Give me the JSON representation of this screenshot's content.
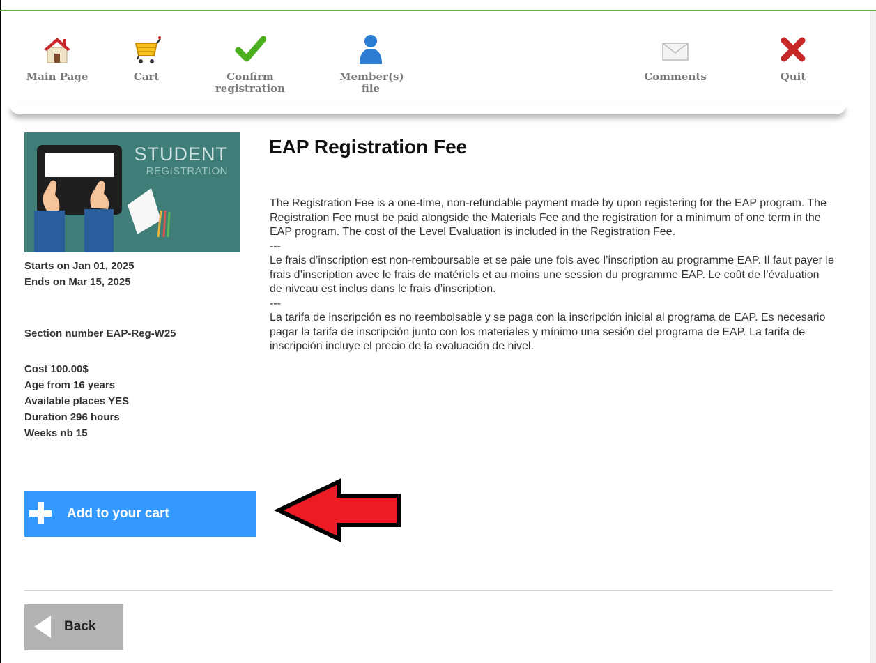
{
  "nav": {
    "items": [
      {
        "label": "Main Page",
        "icon": "home-icon"
      },
      {
        "label": "Cart",
        "icon": "cart-icon"
      },
      {
        "label": "Confirm registration",
        "icon": "checkmark-icon"
      },
      {
        "label": "Member(s) file",
        "icon": "person-icon"
      },
      {
        "label": "Comments",
        "icon": "envelope-icon"
      },
      {
        "label": "Quit",
        "icon": "close-icon"
      }
    ]
  },
  "course": {
    "image_text": {
      "line1": "STUDENT",
      "line2": "REGISTRATION"
    },
    "title": "EAP Registration Fee",
    "starts": "Starts on Jan 01, 2025",
    "ends": "Ends on Mar 15, 2025",
    "section": "Section number EAP-Reg-W25",
    "cost": "Cost 100.00$",
    "age": "Age from 16 years",
    "available": "Available places YES",
    "duration": "Duration 296 hours",
    "weeks": "Weeks nb 15",
    "description": {
      "en": "The Registration Fee is a one-time, non-refundable payment made by upon registering for the EAP program. The Registration Fee must be paid alongside the Materials Fee and the registration for a minimum of one term in the EAP program. The cost of the Level Evaluation is included in the Registration Fee.",
      "sep1": "---",
      "fr": "Le frais d’inscription est non-remboursable et se paie une fois avec l’inscription au programme EAP. Il faut payer le frais d’inscription avec le frais de matériels et au moins une session du programme EAP. Le coût de l’évaluation de niveau est inclus dans le frais d’inscription.",
      "sep2": "---",
      "es": "La tarifa de inscripción es no reembolsable y se paga con la inscripción inicial al programa de EAP. Es necesario pagar la tarifa de inscripción junto con los materiales y mínimo una sesión del programa de EAP. La tarifa de inscripción incluye el precio de la evaluación de nivel."
    }
  },
  "actions": {
    "add_to_cart": "Add to your cart",
    "back": "Back"
  },
  "colors": {
    "accent_blue": "#3399ff",
    "back_gray": "#b3b3b3",
    "arrow_red": "#ed1c24",
    "image_teal": "#3f7e78",
    "top_line_green": "#6aa84f"
  }
}
